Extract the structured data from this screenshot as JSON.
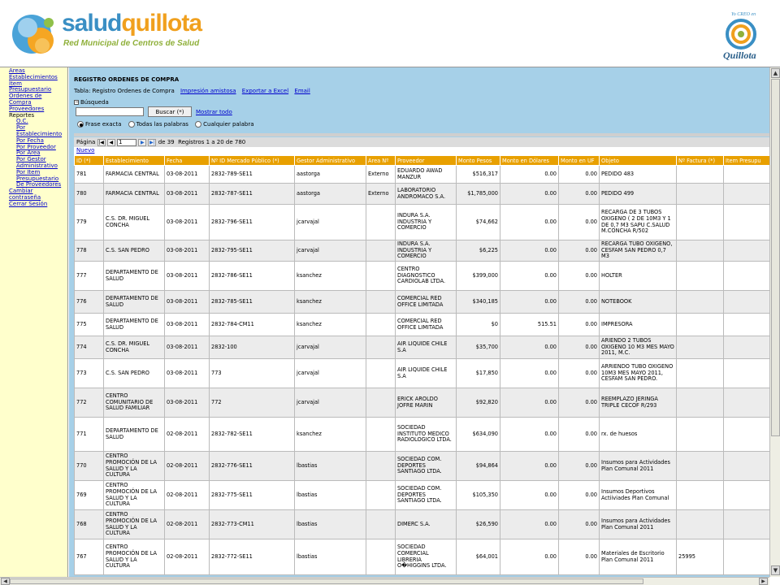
{
  "header": {
    "brand_part1": "salud",
    "brand_part2": "quillota",
    "subtitle": "Red Municipal de Centros de Salud",
    "seal_text": "Quillota",
    "seal_small": "Yo CREO en"
  },
  "sidebar": {
    "items": [
      {
        "label": "Areas",
        "sub": false,
        "link": true
      },
      {
        "label": "Establecimientos",
        "sub": false,
        "link": true
      },
      {
        "label": "Item",
        "sub": false,
        "link": true
      },
      {
        "label": "Presupuestario",
        "sub": false,
        "link": true
      },
      {
        "label": "Ordenes de",
        "sub": false,
        "link": true
      },
      {
        "label": "Compra",
        "sub": false,
        "link": true
      },
      {
        "label": "Proveedores",
        "sub": false,
        "link": true
      },
      {
        "label": "Reportes",
        "sub": false,
        "link": false
      },
      {
        "label": "O.C.",
        "sub": true,
        "link": true
      },
      {
        "label": "Por",
        "sub": true,
        "link": true
      },
      {
        "label": "Establecimiento",
        "sub": true,
        "link": true
      },
      {
        "label": "Por Fecha",
        "sub": true,
        "link": true
      },
      {
        "label": "Por Proveedor",
        "sub": true,
        "link": true
      },
      {
        "label": "Por Area",
        "sub": true,
        "link": true
      },
      {
        "label": "Por Gestor",
        "sub": true,
        "link": true
      },
      {
        "label": "Administrativo",
        "sub": true,
        "link": true
      },
      {
        "label": "Por Item",
        "sub": true,
        "link": true
      },
      {
        "label": "Presupuestario",
        "sub": true,
        "link": true
      },
      {
        "label": "De Proveedores",
        "sub": true,
        "link": true
      },
      {
        "label": "Cambiar",
        "sub": false,
        "link": true
      },
      {
        "label": "contraseña",
        "sub": false,
        "link": true
      },
      {
        "label": "Cerrar Sesión",
        "sub": false,
        "link": true
      }
    ]
  },
  "main": {
    "title": "REGISTRO ORDENES DE COMPRA",
    "tabla_label": "Tabla: Registro Ordenes de Compra",
    "link_print": "Impresión amistosa",
    "link_excel": "Exportar a Excel",
    "link_email": "Email",
    "busqueda_label": "Búsqueda",
    "search_value": "",
    "buscar_button": "Buscar (*)",
    "mostrar_todo": "Mostrar todo",
    "radios": [
      "Frase exacta",
      "Todas las palabras",
      "Cualquier palabra"
    ],
    "pager": {
      "pagina_label": "Página",
      "current_page": "1",
      "total_pages": "de 39",
      "registros": "Registros 1 a 20 de 780"
    },
    "nuevo": "Nuevo"
  },
  "table": {
    "columns": [
      "ID (*)",
      "Establecimiento",
      "Fecha",
      "Nº ID Mercado Público (*)",
      "Gestor Administrativo",
      "Area Nº",
      "Proveedor",
      "Monto Pesos",
      "Monto en Dólares",
      "Monto en UF",
      "Objeto",
      "Nº Factura (*)",
      "Item Presupu"
    ],
    "rows": [
      [
        "781",
        "FARMACIA CENTRAL",
        "03-08-2011",
        "2832-789-SE11",
        "aastorga",
        "Externo",
        "EDUARDO AWAD MANZUR",
        "$516,317",
        "0.00",
        "0.00",
        "PEDIDO 483",
        "",
        ""
      ],
      [
        "780",
        "FARMACIA CENTRAL",
        "03-08-2011",
        "2832-787-SE11",
        "aastorga",
        "Externo",
        "LABORATORIO ANDROMACO S.A.",
        "$1,785,000",
        "0.00",
        "0.00",
        "PEDIDO 499",
        "",
        ""
      ],
      [
        "779",
        "C.S. DR. MIGUEL CONCHA",
        "03-08-2011",
        "2832-796-SE11",
        "jcarvajal",
        "",
        "INDURA S.A. INDUSTRIA Y COMERCIO",
        "$74,662",
        "0.00",
        "0.00",
        "RECARGA DE 3 TUBOS OXIGENO ( 2 DE 10M3 Y 1 DE 0,7 M3 SAPU C.SALUD M.CONCHA R/502",
        "",
        ""
      ],
      [
        "778",
        "C.S. SAN PEDRO",
        "03-08-2011",
        "2832-795-SE11",
        "jcarvajal",
        "",
        "INDURA S.A. INDUSTRIA Y COMERCIO",
        "$6,225",
        "0.00",
        "0.00",
        "RECARGA TUBO OXIGENO, CESFAM SAN PEDRO 0,7 M3",
        "",
        ""
      ],
      [
        "777",
        "DEPARTAMENTO DE SALUD",
        "03-08-2011",
        "2832-786-SE11",
        "ksanchez",
        "",
        "CENTRO DIAGNOSTICO CARDIOLAB LTDA.",
        "$399,000",
        "0.00",
        "0.00",
        "HOLTER",
        "",
        ""
      ],
      [
        "776",
        "DEPARTAMENTO DE SALUD",
        "03-08-2011",
        "2832-785-SE11",
        "ksanchez",
        "",
        "COMERCIAL RED OFFICE LIMITADA",
        "$340,185",
        "0.00",
        "0.00",
        "NOTEBOOK",
        "",
        ""
      ],
      [
        "775",
        "DEPARTAMENTO DE SALUD",
        "03-08-2011",
        "2832-784-CM11",
        "ksanchez",
        "",
        "COMERCIAL RED OFFICE LIMITADA",
        "$0",
        "515.51",
        "0.00",
        "IMPRESORA",
        "",
        ""
      ],
      [
        "774",
        "C.S. DR. MIGUEL CONCHA",
        "03-08-2011",
        "2832-100",
        "jcarvajal",
        "",
        "AIR LIQUIDE CHILE S.A",
        "$35,700",
        "0.00",
        "0.00",
        "ARIENDO 2 TUBOS OXIGENO 10 M3 MES MAYO 2011, M.C.",
        "",
        ""
      ],
      [
        "773",
        "C.S. SAN PEDRO",
        "03-08-2011",
        "773",
        "jcarvajal",
        "",
        "AIR LIQUIDE CHILE S.A",
        "$17,850",
        "0.00",
        "0.00",
        "ARRIENDO TUBO OXIGENO 10M3 MES MAYO 2011, CESFAM SAN PEDRO.",
        "",
        ""
      ],
      [
        "772",
        "CENTRO COMUNITARIO DE SALUD FAMILIAR",
        "03-08-2011",
        "772",
        "jcarvajal",
        "",
        "ERICK AROLDO JOFRE MARIN",
        "$92,820",
        "0.00",
        "0.00",
        "REEMPLAZO JERINGA TRIPLE CECOF R/293",
        "",
        ""
      ],
      [
        "771",
        "DEPARTAMENTO DE SALUD",
        "02-08-2011",
        "2832-782-SE11",
        "ksanchez",
        "",
        "SOCIEDAD INSTITUTO MEDICO RADIOLOGICO LTDA.",
        "$634,090",
        "0.00",
        "0.00",
        "rx. de huesos",
        "",
        ""
      ],
      [
        "770",
        "CENTRO PROMOCIÓN DE LA SALUD Y LA CULTURA",
        "02-08-2011",
        "2832-776-SE11",
        "lbastias",
        "",
        "SOCIEDAD COM. DEPORTES SANTIAGO LTDA.",
        "$94,864",
        "0.00",
        "0.00",
        "Insumos para Actividades Plan Comunal 2011",
        "",
        ""
      ],
      [
        "769",
        "CENTRO PROMOCIÓN DE LA SALUD Y LA CULTURA",
        "02-08-2011",
        "2832-775-SE11",
        "lbastias",
        "",
        "SOCIEDAD COM. DEPORTES SANTIAGO LTDA.",
        "$105,350",
        "0.00",
        "0.00",
        "Insumos Deportivos Actiiviades Plan Comunal",
        "",
        ""
      ],
      [
        "768",
        "CENTRO PROMOCIÓN DE LA SALUD Y LA CULTURA",
        "02-08-2011",
        "2832-773-CM11",
        "lbastias",
        "",
        "DIMERC S.A.",
        "$26,590",
        "0.00",
        "0.00",
        "Insumos para Actividades Plan Comunal 2011",
        "",
        ""
      ],
      [
        "767",
        "CENTRO PROMOCIÓN DE LA SALUD Y LA CULTURA",
        "02-08-2011",
        "2832-772-SE11",
        "lbastias",
        "",
        "SOCIEDAD COMERCIAL LIBRERIA O�HIGGINS LTDA.",
        "$64,001",
        "0.00",
        "0.00",
        "Materiales de Escritorio Plan Comunal 2011",
        "25995",
        ""
      ]
    ]
  }
}
